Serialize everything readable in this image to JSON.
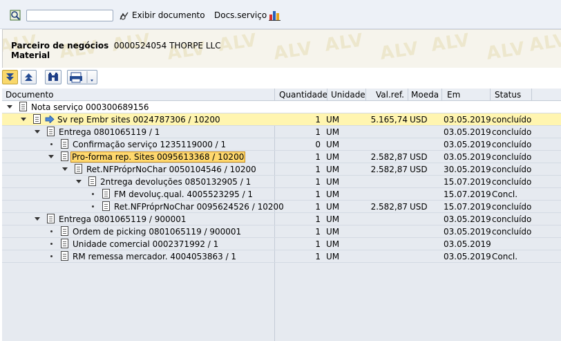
{
  "toolbar": {
    "exibir_label": "Exibir documento",
    "docs_label": "Docs.serviço",
    "command_value": ""
  },
  "header": {
    "partner_label": "Parceiro de negócios",
    "partner_number": "0000524054",
    "partner_name": "THORPE LLC",
    "material_label": "Material",
    "watermark": "ALV"
  },
  "columns": {
    "documento": "Documento",
    "quantidade": "Quantidade",
    "unidade": "Unidade",
    "valref": "Val.ref.",
    "moeda": "Moeda",
    "em": "Em",
    "status": "Status"
  },
  "rows": [
    {
      "doc": "Nota serviço 000300689156",
      "qty": "",
      "unit": "",
      "val": "",
      "cur": "",
      "date": "",
      "status": ""
    },
    {
      "doc": "Sv rep Embr sites 0024787306 / 10200",
      "qty": "1",
      "unit": "UM",
      "val": "5.165,74",
      "cur": "USD",
      "date": "03.05.2019",
      "status": "concluído"
    },
    {
      "doc": "Entrega 0801065119 / 1",
      "qty": "1",
      "unit": "UM",
      "val": "",
      "cur": "",
      "date": "03.05.2019",
      "status": "concluído"
    },
    {
      "doc": "Confirmação serviço 1235119000 / 1",
      "qty": "0",
      "unit": "UM",
      "val": "",
      "cur": "",
      "date": "03.05.2019",
      "status": "concluído"
    },
    {
      "doc": "Pro-forma rep. Sites 0095613368 / 10200",
      "qty": "1",
      "unit": "UM",
      "val": "2.582,87",
      "cur": "USD",
      "date": "03.05.2019",
      "status": "concluído"
    },
    {
      "doc": "Ret.NFPróprNoChar 0050104546 / 10200",
      "qty": "1",
      "unit": "UM",
      "val": "2.582,87",
      "cur": "USD",
      "date": "30.05.2019",
      "status": "concluído"
    },
    {
      "doc": "2ntrega devoluções 0850132905 / 1",
      "qty": "1",
      "unit": "UM",
      "val": "",
      "cur": "",
      "date": "15.07.2019",
      "status": "concluído"
    },
    {
      "doc": "FM devoluç.qual. 4005523295 / 1",
      "qty": "1",
      "unit": "UM",
      "val": "",
      "cur": "",
      "date": "15.07.2019",
      "status": "Concl."
    },
    {
      "doc": "Ret.NFPróprNoChar 0095624526 / 10200",
      "qty": "1",
      "unit": "UM",
      "val": "2.582,87",
      "cur": "USD",
      "date": "15.07.2019",
      "status": "concluído"
    },
    {
      "doc": "Entrega 0801065119 / 900001",
      "qty": "1",
      "unit": "UM",
      "val": "",
      "cur": "",
      "date": "03.05.2019",
      "status": "concluído"
    },
    {
      "doc": "Ordem de picking 0801065119 / 900001",
      "qty": "1",
      "unit": "UM",
      "val": "",
      "cur": "",
      "date": "03.05.2019",
      "status": "concluído"
    },
    {
      "doc": "Unidade comercial 0002371992 / 1",
      "qty": "1",
      "unit": "UM",
      "val": "",
      "cur": "",
      "date": "03.05.2019",
      "status": ""
    },
    {
      "doc": "RM remessa mercador. 4004053863 / 1",
      "qty": "1",
      "unit": "UM",
      "val": "",
      "cur": "",
      "date": "03.05.2019",
      "status": "Concl."
    }
  ]
}
